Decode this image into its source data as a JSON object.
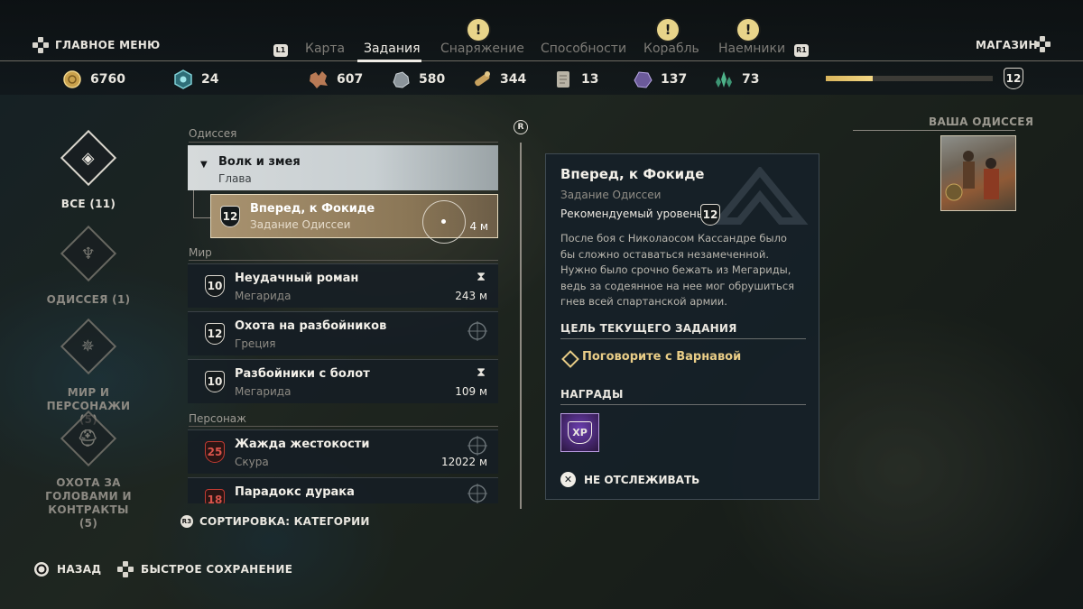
{
  "header": {
    "main_menu": "ГЛАВНОЕ МЕНЮ",
    "shop": "МАГАЗИН",
    "bumper_left": "L1",
    "bumper_right": "R1",
    "tabs": [
      {
        "label": "Карта",
        "active": false,
        "warning": false
      },
      {
        "label": "Задания",
        "active": true,
        "warning": false
      },
      {
        "label": "Снаряжение",
        "active": false,
        "warning": true
      },
      {
        "label": "Способности",
        "active": false,
        "warning": false
      },
      {
        "label": "Корабль",
        "active": false,
        "warning": true
      },
      {
        "label": "Наемники",
        "active": false,
        "warning": true
      }
    ],
    "warning_glyph": "!"
  },
  "resources": {
    "drachmae": "6760",
    "ancient_shards": "24",
    "leather": "607",
    "iron": "580",
    "wood": "344",
    "stone": "13",
    "obsidian": "137",
    "crystal": "73"
  },
  "player": {
    "level": "12",
    "xp_progress": 0.28
  },
  "categories": [
    {
      "label": "ВСЕ (11)",
      "active": true,
      "icon": "all-quests-icon",
      "glyph": "◈"
    },
    {
      "label": "ОДИССЕЯ (1)",
      "active": false,
      "icon": "odyssey-icon",
      "glyph": "♆"
    },
    {
      "label": "МИР И ПЕРСОНАЖИ (5)",
      "active": false,
      "icon": "world-compass-icon",
      "glyph": "✵"
    },
    {
      "label": "ОХОТА ЗА ГОЛОВАМИ И КОНТРАКТЫ (5)",
      "active": false,
      "icon": "helmet-icon",
      "glyph": "⛑"
    }
  ],
  "quest_list": {
    "sections": {
      "odyssey": "Одиссея",
      "world": "Мир",
      "character": "Персонаж"
    },
    "chapter": {
      "title": "Волк и змея",
      "sub": "Глава"
    },
    "selected": {
      "level": "12",
      "title": "Вперед, к Фокиде",
      "sub": "Задание Одиссеи",
      "dist": "4 м"
    },
    "world": [
      {
        "level": "10",
        "title": "Неудачный роман",
        "sub": "Мегарида",
        "dist": "243 м",
        "timed": true
      },
      {
        "level": "12",
        "title": "Охота на разбойников",
        "sub": "Греция",
        "dist": "",
        "timed": false
      },
      {
        "level": "10",
        "title": "Разбойники с болот",
        "sub": "Мегарида",
        "dist": "109 м",
        "timed": true
      }
    ],
    "character": [
      {
        "level": "25",
        "title": "Жажда жестокости",
        "sub": "Скура",
        "dist": "12022 м"
      },
      {
        "level": "18",
        "title": "Парадокс дурака",
        "sub": "",
        "dist": ""
      }
    ],
    "scroll_button": "R"
  },
  "details": {
    "title": "Вперед, к Фокиде",
    "type": "Задание Одиссеи",
    "recommended_label": "Рекомендуемый уровень",
    "recommended_level": "12",
    "description": "После боя с Николаосом Кассандре было бы сложно оставаться незамеченной. Нужно было срочно бежать из Мегариды, ведь за содеянное на нее мог обрушиться гнев всей спартанской армии.",
    "objective_header": "ЦЕЛЬ ТЕКУЩЕГО ЗАДАНИЯ",
    "objective": "Поговорите с Варнавой",
    "rewards_header": "НАГРАДЫ",
    "reward_xp": "XP",
    "untrack": "НЕ ОТСЛЕЖИВАТЬ"
  },
  "odyssey_panel": {
    "label": "ВАША ОДИССЕЯ"
  },
  "footer": {
    "sort_button": "R3",
    "sort": "СОРТИРОВКА: КАТЕГОРИИ",
    "back": "НАЗАД",
    "quicksave": "БЫСТРОЕ СОХРАНЕНИЕ"
  },
  "colors": {
    "accent_gold": "#e9cd87",
    "panel_bg": "#16202a",
    "danger": "#c23b32",
    "xp_purple": "#6c3fb0"
  }
}
